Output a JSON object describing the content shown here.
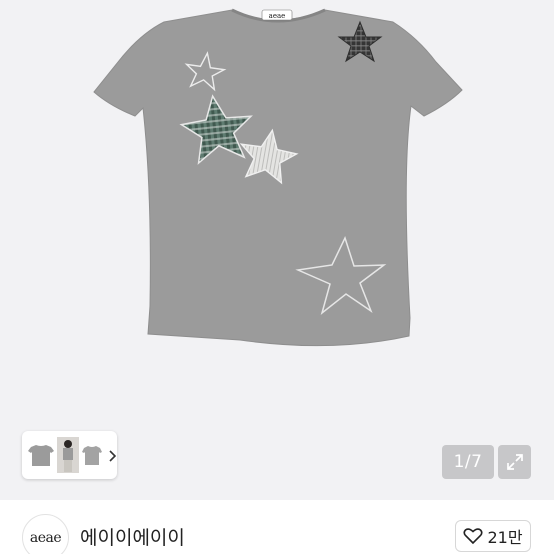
{
  "gallery": {
    "counter": "1/7",
    "thumb_next_icon": "chevron-right-icon",
    "expand_icon": "expand-icon"
  },
  "seller": {
    "avatar_text": "aeae",
    "name": "에이이에이이"
  },
  "like": {
    "icon": "heart-icon",
    "count": "21만"
  },
  "colors": {
    "image_bg": "#f2f2f4",
    "shirt": "#9b9b9b",
    "plaid_green": "#3f5c52"
  }
}
